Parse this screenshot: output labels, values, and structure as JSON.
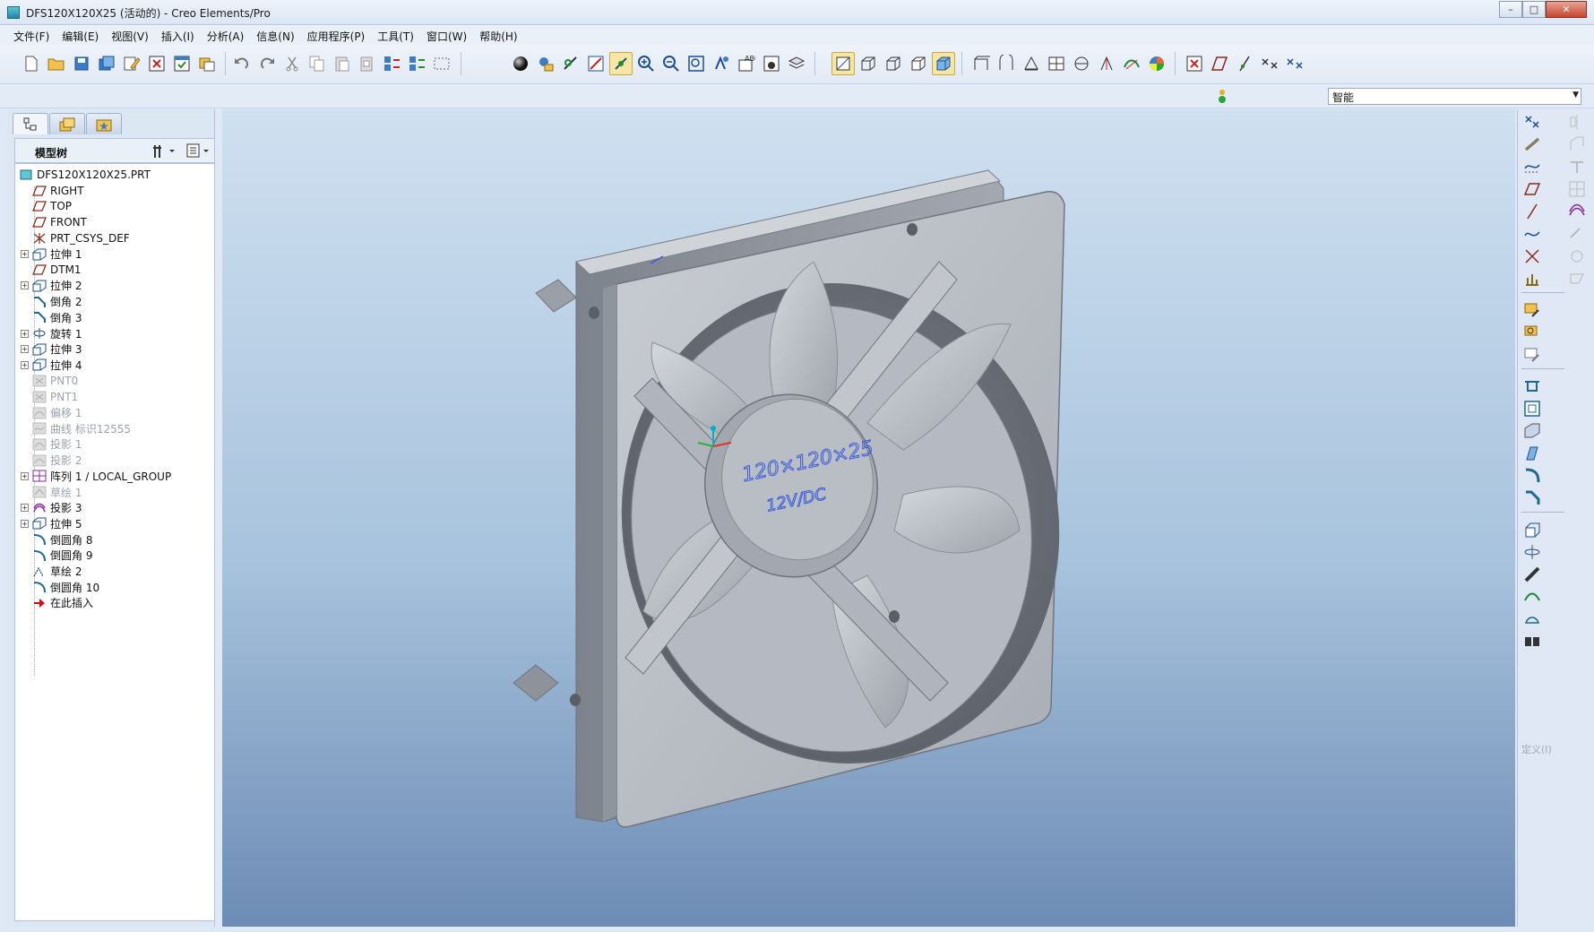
{
  "window": {
    "title": "DFS120X120X25 (活动的) - Creo Elements/Pro",
    "minimize": "–",
    "maximize": "□",
    "close": "✕"
  },
  "menu": [
    "文件(F)",
    "编辑(E)",
    "视图(V)",
    "插入(I)",
    "分析(A)",
    "信息(N)",
    "应用程序(P)",
    "工具(T)",
    "窗口(W)",
    "帮助(H)"
  ],
  "filter": {
    "value": "智能"
  },
  "model_tree": {
    "header": "模型树",
    "items": [
      {
        "label": "DFS120X120X25.PRT",
        "icon": "part-icon",
        "expandable": false,
        "dim": false,
        "indent": 0
      },
      {
        "label": "RIGHT",
        "icon": "datum-plane-icon",
        "expandable": false,
        "dim": false,
        "indent": 1
      },
      {
        "label": "TOP",
        "icon": "datum-plane-icon",
        "expandable": false,
        "dim": false,
        "indent": 1
      },
      {
        "label": "FRONT",
        "icon": "datum-plane-icon",
        "expandable": false,
        "dim": false,
        "indent": 1
      },
      {
        "label": "PRT_CSYS_DEF",
        "icon": "csys-icon",
        "expandable": false,
        "dim": false,
        "indent": 1
      },
      {
        "label": "拉伸 1",
        "icon": "extrude-icon",
        "expandable": true,
        "dim": false,
        "indent": 1
      },
      {
        "label": "DTM1",
        "icon": "datum-plane-icon",
        "expandable": false,
        "dim": false,
        "indent": 1
      },
      {
        "label": "拉伸 2",
        "icon": "extrude-icon",
        "expandable": true,
        "dim": false,
        "indent": 1
      },
      {
        "label": "倒角 2",
        "icon": "chamfer-icon",
        "expandable": false,
        "dim": false,
        "indent": 1
      },
      {
        "label": "倒角 3",
        "icon": "chamfer-icon",
        "expandable": false,
        "dim": false,
        "indent": 1
      },
      {
        "label": "旋转 1",
        "icon": "revolve-icon",
        "expandable": true,
        "dim": false,
        "indent": 1
      },
      {
        "label": "拉伸 3",
        "icon": "extrude-icon",
        "expandable": true,
        "dim": false,
        "indent": 1
      },
      {
        "label": "拉伸 4",
        "icon": "extrude-icon",
        "expandable": true,
        "dim": false,
        "indent": 1
      },
      {
        "label": "PNT0",
        "icon": "point-icon",
        "expandable": false,
        "dim": true,
        "indent": 1
      },
      {
        "label": "PNT1",
        "icon": "point-icon",
        "expandable": false,
        "dim": true,
        "indent": 1
      },
      {
        "label": "偏移 1",
        "icon": "offset-icon",
        "expandable": false,
        "dim": true,
        "indent": 1
      },
      {
        "label": "曲线 标识12555",
        "icon": "curve-icon",
        "expandable": false,
        "dim": true,
        "indent": 1
      },
      {
        "label": "投影 1",
        "icon": "project-icon",
        "expandable": false,
        "dim": true,
        "indent": 1
      },
      {
        "label": "投影 2",
        "icon": "project-icon",
        "expandable": false,
        "dim": true,
        "indent": 1
      },
      {
        "label": "阵列 1 / LOCAL_GROUP",
        "icon": "pattern-icon",
        "expandable": true,
        "dim": false,
        "indent": 1
      },
      {
        "label": "草绘 1",
        "icon": "sketch-icon",
        "expandable": false,
        "dim": true,
        "indent": 1
      },
      {
        "label": "投影 3",
        "icon": "project-icon",
        "expandable": true,
        "dim": false,
        "indent": 1
      },
      {
        "label": "拉伸 5",
        "icon": "extrude-icon",
        "expandable": true,
        "dim": false,
        "indent": 1
      },
      {
        "label": "倒圆角 8",
        "icon": "round-icon",
        "expandable": false,
        "dim": false,
        "indent": 1
      },
      {
        "label": "倒圆角 9",
        "icon": "round-icon",
        "expandable": false,
        "dim": false,
        "indent": 1
      },
      {
        "label": "草绘 2",
        "icon": "sketch-icon",
        "expandable": false,
        "dim": false,
        "indent": 1
      },
      {
        "label": "倒圆角 10",
        "icon": "round-icon",
        "expandable": false,
        "dim": false,
        "indent": 1
      },
      {
        "label": "在此插入",
        "icon": "insert-here-icon",
        "expandable": false,
        "dim": false,
        "indent": 1
      }
    ]
  },
  "model": {
    "hub_text_1": "120×120×25",
    "hub_text_2": "12V/DC"
  },
  "right_toolbar": {
    "define_label": "定义(I)"
  },
  "colors": {
    "viewport_top": "#cfe0f0",
    "viewport_bottom": "#6d8cb5",
    "fan_body": "#b9bec6",
    "hub_text": "#3a5ad8"
  }
}
